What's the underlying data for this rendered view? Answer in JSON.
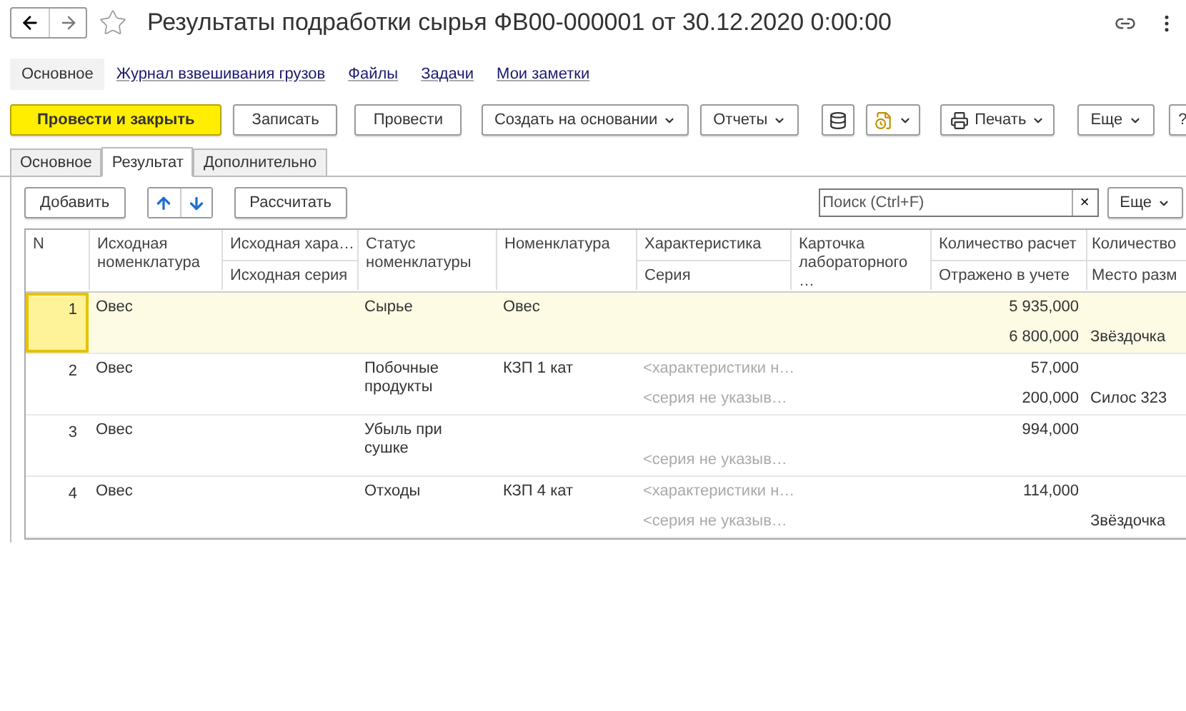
{
  "window": {
    "title": "Результаты подработки сырья ФВ00-000001 от 30.12.2020 0:00:00",
    "favorite": false
  },
  "nav_links": [
    {
      "label": "Основное",
      "selected": true
    },
    {
      "label": "Журнал взвешивания грузов",
      "selected": false
    },
    {
      "label": "Файлы",
      "selected": false
    },
    {
      "label": "Задачи",
      "selected": false
    },
    {
      "label": "Мои заметки",
      "selected": false
    }
  ],
  "command_bar": [
    {
      "kind": "primary",
      "label": "Провести и закрыть"
    },
    {
      "kind": "button",
      "label": "Записать"
    },
    {
      "kind": "button",
      "label": "Провести"
    },
    {
      "kind": "menu",
      "label": "Создать на основании"
    },
    {
      "kind": "menu",
      "label": "Отчеты"
    },
    {
      "kind": "list"
    },
    {
      "kind": "document"
    },
    {
      "kind": "print",
      "label": "Печать"
    }
  ],
  "more_button": "Еще",
  "help_button": "?",
  "tabs": [
    {
      "label": "Основное",
      "selected": false
    },
    {
      "label": "Результат",
      "selected": true
    },
    {
      "label": "Дополнительно",
      "selected": false
    }
  ],
  "table_toolbar": {
    "add": "Добавить",
    "calculate": "Рассчитать",
    "search": {
      "placeholder": "Поиск (Ctrl+F)"
    },
    "clear": "×",
    "more": "Еще"
  },
  "table": {
    "columns": [
      {
        "top": "N"
      },
      {
        "top": "Исходная номенклатура"
      },
      {
        "top": "Исходная хара…",
        "bottom": "Исходная серия"
      },
      {
        "top": "Статус номенклатуры"
      },
      {
        "top": "Номенклатура"
      },
      {
        "top": "Характеристика",
        "bottom": "Серия"
      },
      {
        "top": "Карточка лабораторного …"
      },
      {
        "top": "Количество расчет",
        "bottom": "Отражено в учете"
      },
      {
        "top": "Количество",
        "bottom": "Место разм"
      }
    ],
    "rows": [
      {
        "selected": true,
        "cells": [
          {
            "top": {
              "text": "1"
            }
          },
          {
            "top": {
              "text": "Овес"
            }
          },
          {},
          {
            "top": {
              "text": "Сырье"
            }
          },
          {
            "top": {
              "text": "Овес"
            }
          },
          {},
          {},
          {
            "top": {
              "text": "5 935,000"
            },
            "bottom": {
              "text": "6 800,000"
            }
          },
          {
            "bottom": {
              "text": "Звёздочка"
            }
          }
        ]
      },
      {
        "selected": false,
        "cells": [
          {
            "top": {
              "text": "2"
            }
          },
          {
            "top": {
              "text": "Овес"
            }
          },
          {},
          {
            "top": {
              "text": "Побочные продукты"
            }
          },
          {
            "top": {
              "text": "КЗП 1 кат"
            }
          },
          {
            "top": {
              "text": "<характеристики н…",
              "muted": true
            },
            "bottom": {
              "text": "<серия не указыв…",
              "muted": true
            }
          },
          {},
          {
            "top": {
              "text": "57,000"
            },
            "bottom": {
              "text": "200,000"
            }
          },
          {
            "bottom": {
              "text": "Силос 323"
            }
          }
        ]
      },
      {
        "selected": false,
        "cells": [
          {
            "top": {
              "text": "3"
            }
          },
          {
            "top": {
              "text": "Овес"
            }
          },
          {},
          {
            "top": {
              "text": "Убыль при сушке"
            }
          },
          {},
          {
            "bottom": {
              "text": "<серия не указыв…",
              "muted": true
            }
          },
          {},
          {
            "top": {
              "text": "994,000"
            }
          },
          {}
        ]
      },
      {
        "selected": false,
        "cells": [
          {
            "top": {
              "text": "4"
            }
          },
          {
            "top": {
              "text": "Овес"
            }
          },
          {},
          {
            "top": {
              "text": "Отходы"
            }
          },
          {
            "top": {
              "text": "КЗП 4 кат"
            }
          },
          {
            "top": {
              "text": "<характеристики н…",
              "muted": true
            },
            "bottom": {
              "text": "<серия не указыв…",
              "muted": true
            }
          },
          {},
          {
            "top": {
              "text": "114,000"
            }
          },
          {
            "bottom": {
              "text": "Звёздочка"
            }
          }
        ]
      }
    ]
  }
}
